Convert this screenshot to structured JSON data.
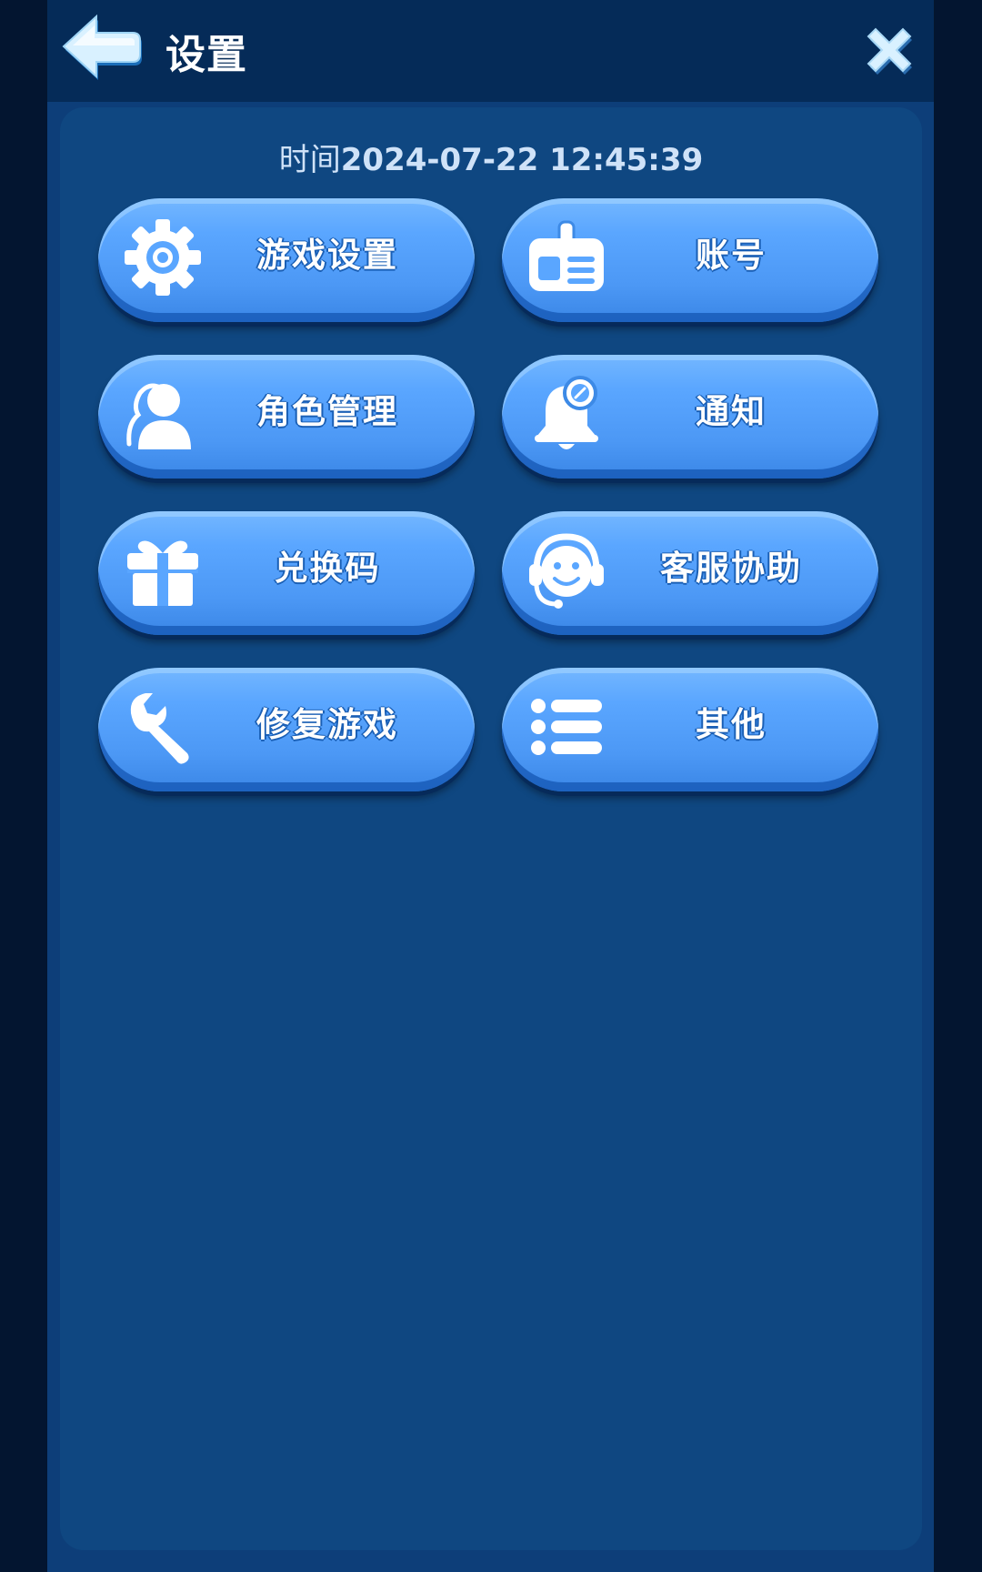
{
  "header": {
    "title": "设置",
    "back_icon": "back-arrow-icon",
    "close_icon": "close-icon"
  },
  "panel": {
    "time_label": "时间",
    "time_value": "2024-07-22 12:45:39"
  },
  "menu": [
    {
      "label": "游戏设置",
      "icon": "gear-icon"
    },
    {
      "label": "账号",
      "icon": "id-card-icon"
    },
    {
      "label": "角色管理",
      "icon": "users-icon"
    },
    {
      "label": "通知",
      "icon": "bell-icon"
    },
    {
      "label": "兑换码",
      "icon": "gift-icon"
    },
    {
      "label": "客服协助",
      "icon": "headset-icon"
    },
    {
      "label": "修复游戏",
      "icon": "wrench-icon"
    },
    {
      "label": "其他",
      "icon": "list-icon"
    }
  ],
  "colors": {
    "header_bg": "#052b58",
    "panel_bg": "#0f4781",
    "button": "#4c98f5",
    "icon": "#ffffff"
  }
}
